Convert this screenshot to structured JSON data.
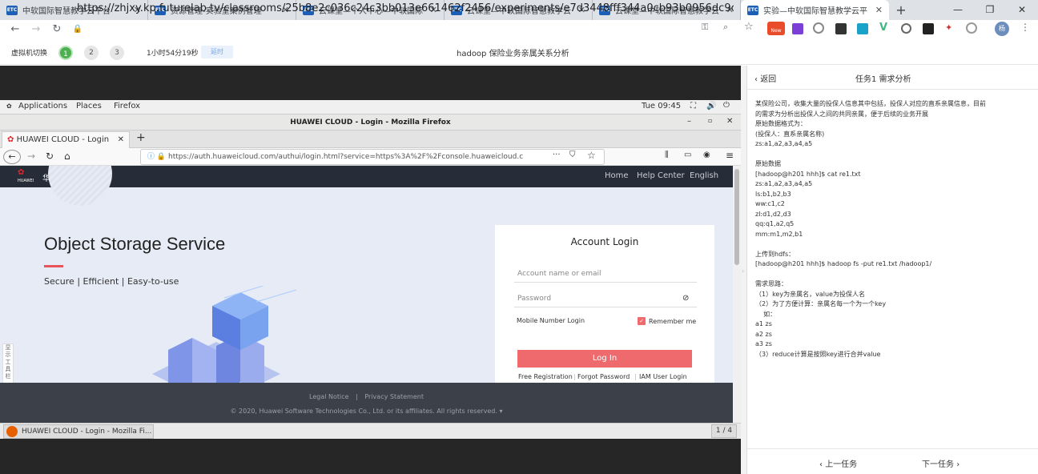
{
  "browser": {
    "tabs": [
      {
        "icon": "ETC",
        "label": "中软国际智慧教学云平台"
      },
      {
        "icon": "ETC",
        "label": "资源管理-实验室案例管理"
      },
      {
        "icon": "ETC",
        "label": "云课堂—个人中心—中软国际"
      },
      {
        "icon": "ETC",
        "label": "云课堂—中软国际智慧教学云"
      },
      {
        "icon": "ETC",
        "label": "云课堂—中软国际智慧教学云"
      },
      {
        "icon": "ETC",
        "label": "实验—中软国际智慧教学云平"
      }
    ],
    "new_tab": "+",
    "url": "https://zhjxy.kp.futurelab.tv/classrooms/25b8e2c036c24c3bb013e661462f2456/experiments/e7d3448fff344a0cb93b0956dc9c488...",
    "ext_new_label": "New",
    "profile_label": "杨"
  },
  "app": {
    "vm_switch_label": "虚拟机切换",
    "vm_numbers": [
      "1",
      "2",
      "3"
    ],
    "timer": "1小时54分19秒",
    "delay_label": "延时",
    "title": "hadoop 保险业务亲属关系分析"
  },
  "vm": {
    "gnome": {
      "applications": "Applications",
      "places": "Places",
      "firefox": "Firefox",
      "clock": "Tue 09:45"
    },
    "firefox": {
      "window_title": "HUAWEI CLOUD - Login - Mozilla Firefox",
      "tab_label": "HUAWEI CLOUD - Login",
      "url": "https://auth.huaweicloud.com/authui/login.html?service=https%3A%2F%2Fconsole.huaweicloud.c",
      "url_dots": "···"
    },
    "huawei": {
      "brand_small": "HUAWEI",
      "brand": "华为云",
      "nav": [
        "Home",
        "Help Center",
        "English"
      ],
      "hero_title": "Object Storage Service",
      "hero_sub": "Secure | Efficient | Easy-to-use",
      "side_tool": "显示工具栏",
      "login": {
        "title": "Account Login",
        "account_placeholder": "Account name or email",
        "password_placeholder": "Password",
        "mobile_login": "Mobile Number Login",
        "remember": "Remember me",
        "login_btn": "Log In",
        "free_reg": "Free Registration",
        "forgot": "Forgot Password",
        "iam": "IAM User Login",
        "sep": "|"
      },
      "footer": {
        "legal": "Legal Notice",
        "privacy": "Privacy Statement",
        "sep": "|",
        "copyright": "© 2020, Huawei Software Technologies Co., Ltd. or its affiliates. All rights reserved."
      }
    },
    "taskbar": {
      "item": "HUAWEI CLOUD - Login - Mozilla Fi...",
      "pager": "1 / 4"
    }
  },
  "panel": {
    "back": "返回",
    "title": "任务1 需求分析",
    "lines": [
      "某保险公司，收集大量的投保人信息其中包括，投保人对应的直系亲属信息，目前",
      "的需求为分析出投保人之间的共同亲属，便于后续的业务开展",
      "原始数据格式为：",
      "(投保人：直系亲属名称)",
      "zs:a1,a2,a3,a4,a5",
      "",
      "原始数据",
      "[hadoop@h201 hhh]$ cat re1.txt",
      "zs:a1,a2,a3,a4,a5",
      "ls:b1,b2,b3",
      "ww:c1,c2",
      "zl:d1,d2,d3",
      "qq:q1,a2,q5",
      "mm:m1,m2,b1",
      "",
      "上传到hdfs：",
      "[hadoop@h201 hhh]$ hadoop fs -put re1.txt /hadoop1/",
      "",
      "需求思路：",
      "（1）key为亲属名，value为投保人名",
      "（2）为了方便计算：亲属名每一个为一个key",
      "    如：",
      "a1 zs",
      "a2 zs",
      "a3 zs",
      "（3）reduce计算是按照key进行合并value"
    ],
    "prev": "上一任务",
    "next": "下一任务"
  }
}
